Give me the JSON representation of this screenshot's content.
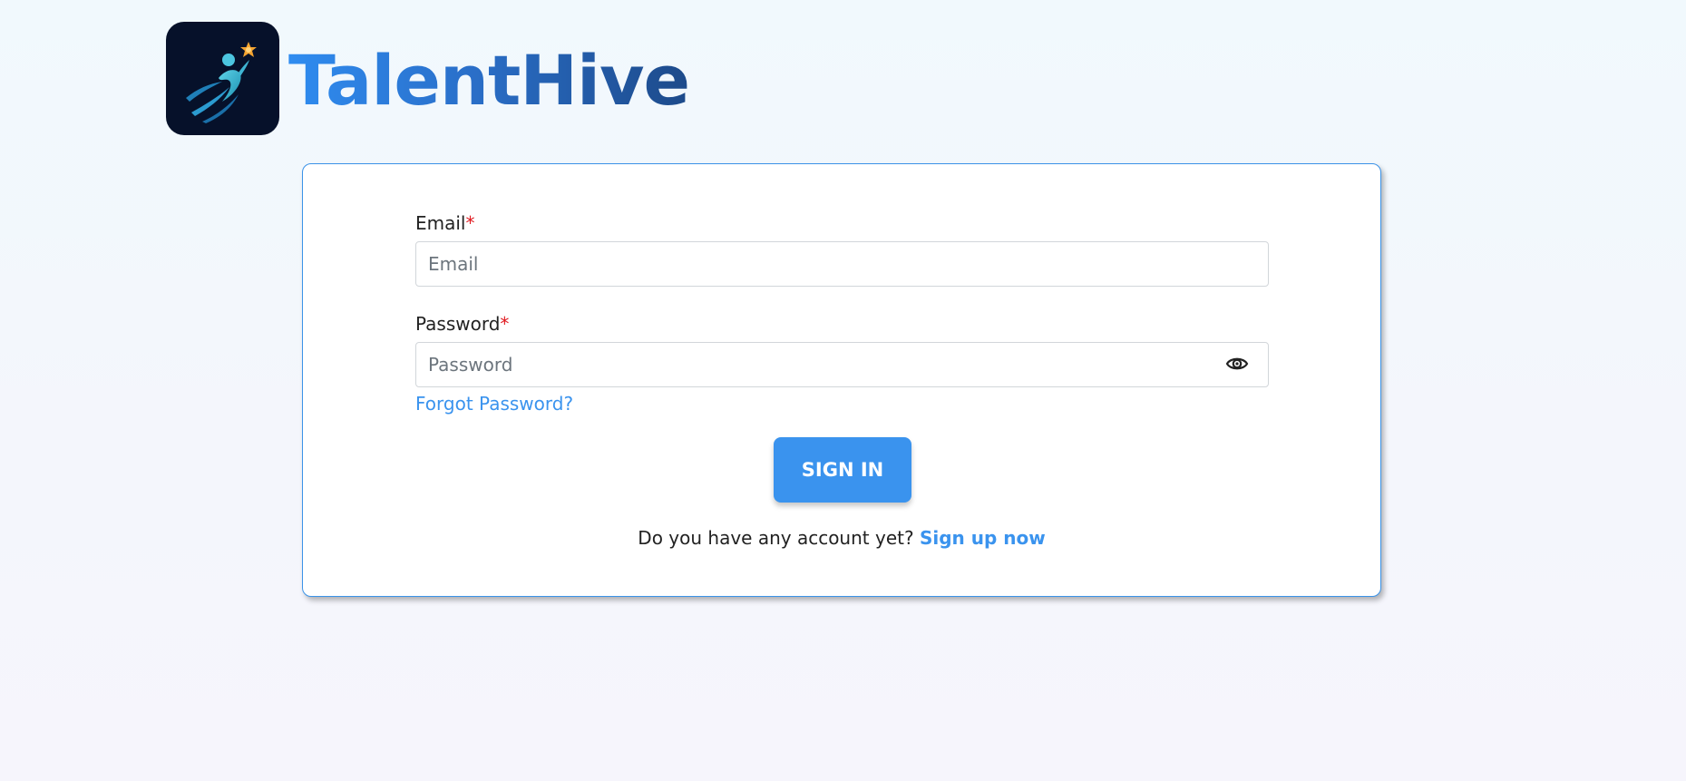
{
  "brand": {
    "name": "TalentHive",
    "logo_icon": "runner-star-icon"
  },
  "login_form": {
    "email": {
      "label": "Email",
      "required_mark": "*",
      "placeholder": "Email",
      "value": ""
    },
    "password": {
      "label": "Password",
      "required_mark": "*",
      "placeholder": "Password",
      "value": "",
      "toggle_icon": "eye-icon"
    },
    "forgot_password": "Forgot Password?",
    "submit_label": "SIGN IN",
    "signup_prompt": "Do you have any account yet?",
    "signup_link": "Sign up now"
  },
  "colors": {
    "accent": "#3a93ee",
    "required": "#e0191f",
    "card_border": "#3b93e8",
    "logo_background": "#06112a"
  }
}
